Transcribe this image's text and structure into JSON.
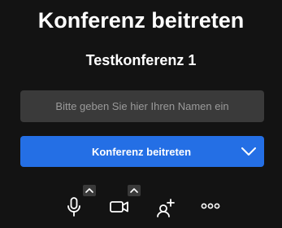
{
  "prejoin": {
    "title": "Konferenz beitreten",
    "meeting_name": "Testkonferenz 1",
    "name_input": {
      "value": "",
      "placeholder": "Bitte geben Sie hier Ihren Namen ein"
    },
    "join_button_label": "Konferenz beitreten",
    "join_options_icon": "chevron-down-icon"
  },
  "toolbar": {
    "items": [
      {
        "icon": "microphone-icon",
        "has_options": true,
        "options_icon": "chevron-up-icon"
      },
      {
        "icon": "camera-icon",
        "has_options": true,
        "options_icon": "chevron-up-icon"
      },
      {
        "icon": "invite-people-icon",
        "has_options": false
      },
      {
        "icon": "more-options-icon",
        "has_options": false
      }
    ]
  },
  "colors": {
    "background": "#131313",
    "input_background": "#3a3a3a",
    "primary_button": "#246fe5",
    "text": "#ffffff",
    "placeholder": "#9a9a9a"
  }
}
